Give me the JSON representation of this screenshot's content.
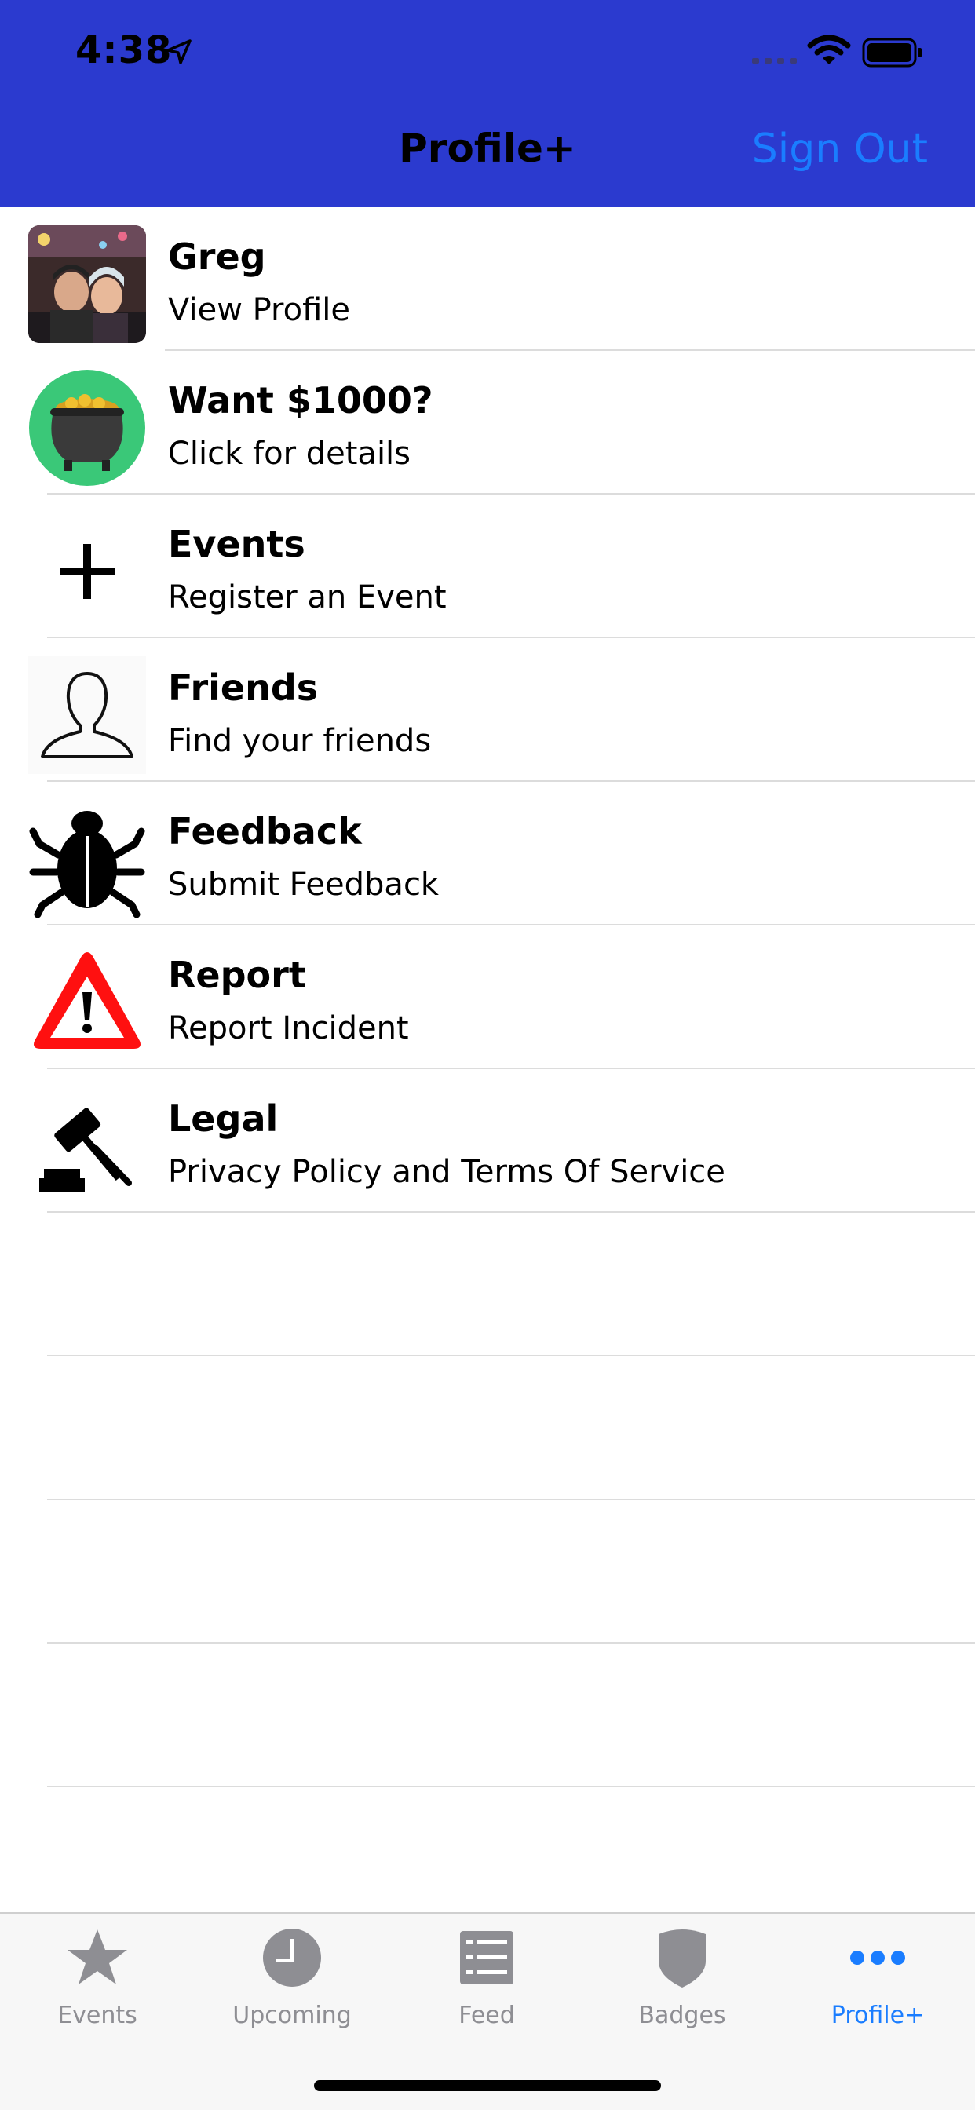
{
  "status_bar": {
    "time": "4:38"
  },
  "nav": {
    "title": "Profile+",
    "sign_out": "Sign Out"
  },
  "colors": {
    "header_bg": "#2b3acf",
    "accent": "#1a7dff",
    "tab_inactive": "#8e8e93"
  },
  "menu": [
    {
      "icon": "profile-photo",
      "title": "Greg",
      "subtitle": "View Profile"
    },
    {
      "icon": "pot-of-gold-icon",
      "title": "Want $1000?",
      "subtitle": "Click for details"
    },
    {
      "icon": "plus-icon",
      "title": "Events",
      "subtitle": "Register an Event"
    },
    {
      "icon": "person-outline-icon",
      "title": "Friends",
      "subtitle": "Find your friends"
    },
    {
      "icon": "bug-icon",
      "title": "Feedback",
      "subtitle": "Submit Feedback"
    },
    {
      "icon": "warning-icon",
      "title": "Report",
      "subtitle": "Report Incident"
    },
    {
      "icon": "gavel-icon",
      "title": "Legal",
      "subtitle": "Privacy Policy and Terms Of Service"
    }
  ],
  "tabs": [
    {
      "icon": "star-icon",
      "label": "Events",
      "active": false
    },
    {
      "icon": "clock-icon",
      "label": "Upcoming",
      "active": false
    },
    {
      "icon": "list-icon",
      "label": "Feed",
      "active": false
    },
    {
      "icon": "shield-icon",
      "label": "Badges",
      "active": false
    },
    {
      "icon": "more-icon",
      "label": "Profile+",
      "active": true
    }
  ]
}
